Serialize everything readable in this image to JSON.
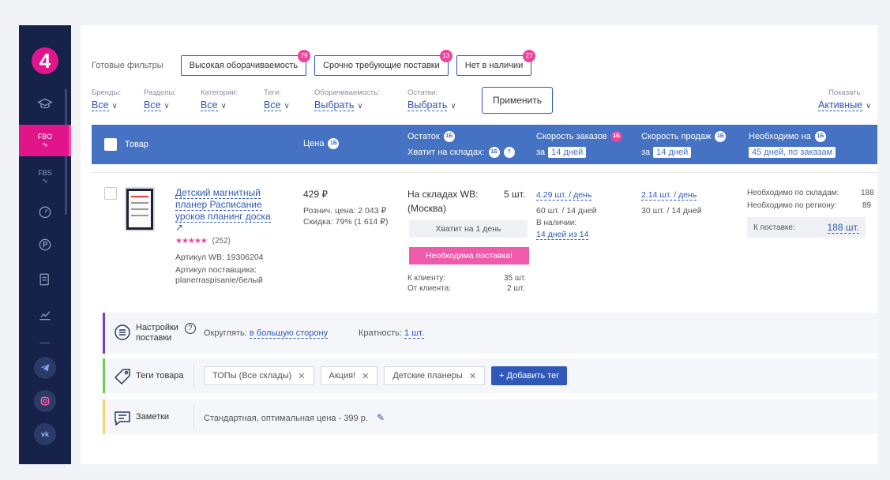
{
  "sidebar": {
    "logo": "4",
    "fbo_label": "FBO",
    "fbs_label": "FBS"
  },
  "filters": {
    "ready_label": "Готовые фильтры",
    "presets": [
      {
        "label": "Высокая оборачиваемость",
        "count": "79"
      },
      {
        "label": "Срочно требующие поставки",
        "count": "13"
      },
      {
        "label": "Нет в наличии",
        "count": "27"
      }
    ],
    "dropdowns": [
      {
        "label": "Бренды:",
        "value": "Все"
      },
      {
        "label": "Разделы:",
        "value": "Все"
      },
      {
        "label": "Категории:",
        "value": "Все"
      },
      {
        "label": "Теги:",
        "value": "Все"
      },
      {
        "label": "Оборачиваемость:",
        "value": "Выбрать"
      },
      {
        "label": "Остатки:",
        "value": "Выбрать"
      }
    ],
    "apply_label": "Применить",
    "show_label": "Показать",
    "show_value": "Активные"
  },
  "table_header": {
    "product": "Товар",
    "price": "Цена",
    "stock": "Остаток",
    "enough": "Хватит на складах:",
    "order_speed": "Скорость заказов",
    "order_period_prefix": "за",
    "order_period": "14 дней",
    "sales_speed": "Скорость продаж",
    "sales_period_prefix": "за",
    "sales_period": "14 дней",
    "needed": "Необходимо на",
    "needed_period": "45 дней, по заказам"
  },
  "product": {
    "name_l1": "Детский магнитный",
    "name_l2": "планер Расписание",
    "name_l3": "уроков планинг доска",
    "reviews": "(252)",
    "article_wb": "Артикул WB: 19306204",
    "article_sup_label": "Артикул поставщика:",
    "article_sup": "planerraspisanie/белый",
    "price": "429 ₽",
    "retail_price": "Рознич. цена: 2 043 ₽",
    "discount": "Скидка: 79% (1 614 ₽)",
    "wh_label": "На складах WB:",
    "wh_city": "(Москва)",
    "wh_qty": "5 шт.",
    "enough_for": "Хватит на 1 день",
    "need_supply": "Необходима поставка!",
    "to_client_label": "К клиенту:",
    "to_client_qty": "35 шт.",
    "from_client_label": "От клиента:",
    "from_client_qty": "2 шт.",
    "order_per_day": "4.29 шт. / день",
    "order_per_period": "60 шт. / 14 дней",
    "availability_label": "В наличии:",
    "availability": "14 дней из 14",
    "sales_per_day": "2.14 шт. / день",
    "sales_per_period": "30 шт. / 14 дней",
    "need_wh_label": "Необходимо по складам:",
    "need_wh": "188",
    "need_region_label": "Необходимо по региону:",
    "need_region": "89",
    "to_supply_label": "К поставке:",
    "to_supply": "188 шт."
  },
  "settings_panel": {
    "title_l1": "Настройки",
    "title_l2": "поставки",
    "rounding_label": "Округлять:",
    "rounding_value": "в большую сторону",
    "multiplicity_label": "Кратность:",
    "multiplicity_value": "1 шт."
  },
  "tags_panel": {
    "title": "Теги товара",
    "tags": [
      "ТОПы (Все склады)",
      "Акция!",
      "Детские планеры"
    ],
    "add_label": "+ Добавить тег"
  },
  "notes_panel": {
    "title": "Заметки",
    "note": "Стандартная, оптимальная цена - 399 р."
  },
  "colors": {
    "accent": "#2f58b8",
    "header": "#4672c4",
    "pink": "#e8479b",
    "sidebar": "#16224a"
  }
}
